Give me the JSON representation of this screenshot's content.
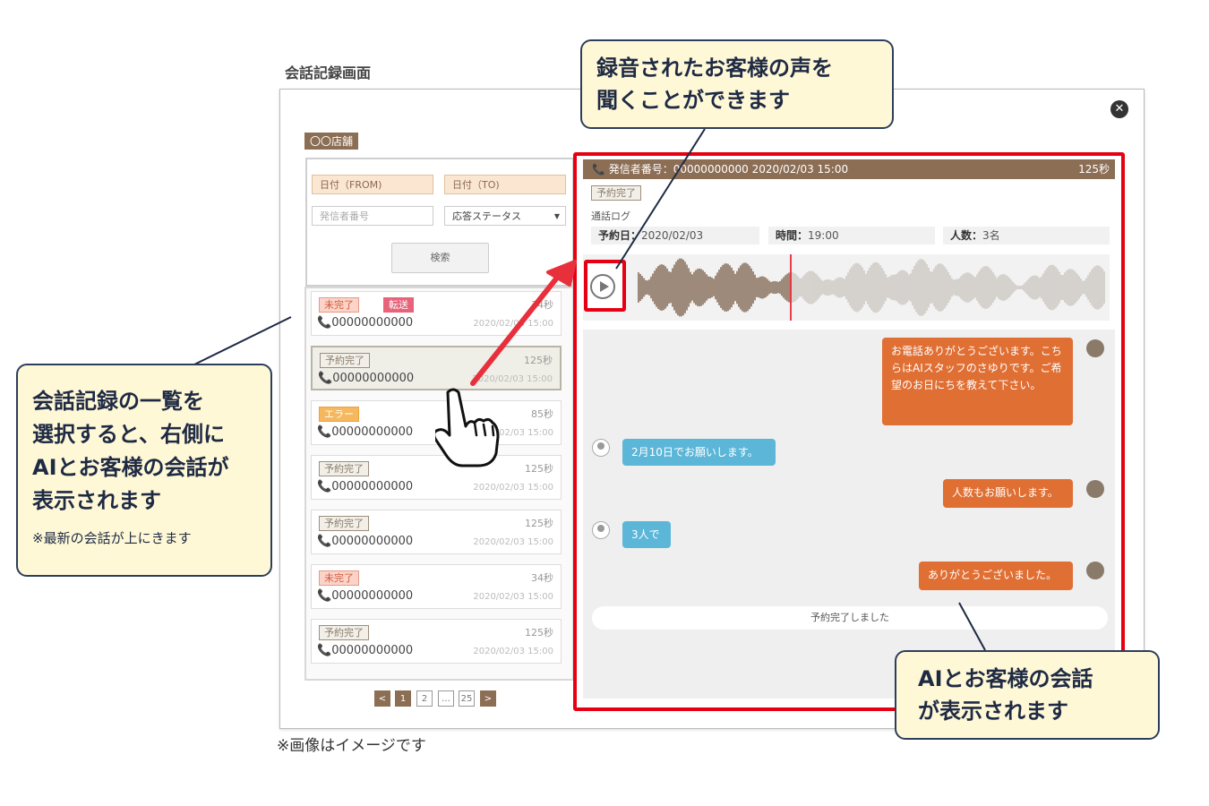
{
  "screen_title": "会話記録画面",
  "store_badge": "〇〇店舗",
  "search": {
    "date_from": "日付（FROM)",
    "date_to": "日付（TO)",
    "caller_placeholder": "発信者番号",
    "status_select": "応答ステータス",
    "button": "検索"
  },
  "records": [
    {
      "tags": [
        "未完了",
        "転送"
      ],
      "secs": "34秒",
      "phone": "00000000000",
      "datetime": "2020/02/03 15:00"
    },
    {
      "tags": [
        "予約完了"
      ],
      "secs": "125秒",
      "phone": "00000000000",
      "datetime": "2020/02/03 15:00"
    },
    {
      "tags": [
        "エラー"
      ],
      "secs": "85秒",
      "phone": "00000000000",
      "datetime": "2020/02/03 15:00"
    },
    {
      "tags": [
        "予約完了"
      ],
      "secs": "125秒",
      "phone": "00000000000",
      "datetime": "2020/02/03 15:00"
    },
    {
      "tags": [
        "予約完了"
      ],
      "secs": "125秒",
      "phone": "00000000000",
      "datetime": "2020/02/03 15:00"
    },
    {
      "tags": [
        "未完了"
      ],
      "secs": "34秒",
      "phone": "00000000000",
      "datetime": "2020/02/03 15:00"
    },
    {
      "tags": [
        "予約完了"
      ],
      "secs": "125秒",
      "phone": "00000000000",
      "datetime": "2020/02/03 15:00"
    }
  ],
  "pagination": {
    "prev": "<",
    "pages": [
      "1",
      "2",
      "…",
      "25"
    ],
    "next": ">",
    "current": "1"
  },
  "detail": {
    "caller_line": "発信者番号：00000000000 2020/02/03 15:00",
    "duration": "125秒",
    "status": "予約完了",
    "log_label": "通話ログ",
    "reserve_date_label": "予約日：",
    "reserve_date": "2020/02/03",
    "time_label": "時間：",
    "time": "19:00",
    "people_label": "人数：",
    "people": "3名",
    "messages": [
      {
        "from": "ai",
        "text": "お電話ありがとうございます。こちらはAIスタッフのさゆりです。ご希望のお日にちを教えて下さい。"
      },
      {
        "from": "user",
        "text": "2月10日でお願いします。"
      },
      {
        "from": "ai",
        "text": "人数もお願いします。"
      },
      {
        "from": "user",
        "text": "3人で"
      },
      {
        "from": "ai",
        "text": "ありがとうございました。"
      }
    ],
    "completion_note": "予約完了しました"
  },
  "callouts": {
    "audio": [
      "録音されたお客様の声を",
      "聞くことができます"
    ],
    "list": [
      "会話記録の一覧を",
      "選択すると、右側に",
      "AIとお客様の会話が",
      "表示されます"
    ],
    "list_note": "※最新の会話が上にきます",
    "chat": [
      "AIとお客様の会話",
      "が表示されます"
    ]
  },
  "disclaimer": "※画像はイメージです",
  "colors": {
    "header": "#8c6e55",
    "highlight": "#e60012",
    "ai_bubble": "#e06f34",
    "user_bubble": "#5cb6d8",
    "callout_bg": "#fff8d6"
  }
}
